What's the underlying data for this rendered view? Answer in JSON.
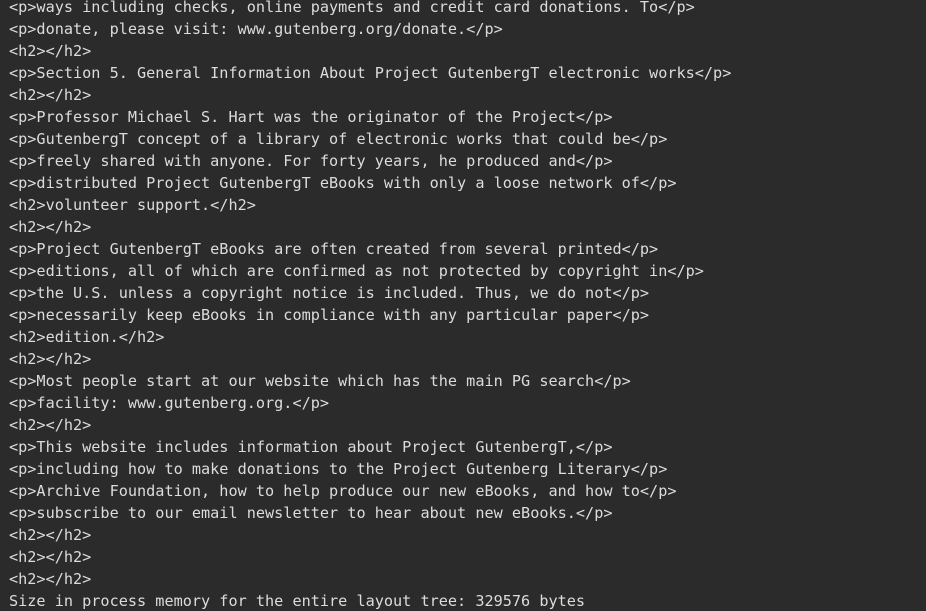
{
  "console": {
    "lines": [
      "<p>ways including checks, online payments and credit card donations. To</p>",
      "<p>donate, please visit: www.gutenberg.org/donate.</p>",
      "<h2></h2>",
      "<p>Section 5. General Information About Project GutenbergT electronic works</p>",
      "<h2></h2>",
      "<p>Professor Michael S. Hart was the originator of the Project</p>",
      "<p>GutenbergT concept of a library of electronic works that could be</p>",
      "<p>freely shared with anyone. For forty years, he produced and</p>",
      "<p>distributed Project GutenbergT eBooks with only a loose network of</p>",
      "<h2>volunteer support.</h2>",
      "<h2></h2>",
      "<p>Project GutenbergT eBooks are often created from several printed</p>",
      "<p>editions, all of which are confirmed as not protected by copyright in</p>",
      "<p>the U.S. unless a copyright notice is included. Thus, we do not</p>",
      "<p>necessarily keep eBooks in compliance with any particular paper</p>",
      "<h2>edition.</h2>",
      "<h2></h2>",
      "<p>Most people start at our website which has the main PG search</p>",
      "<p>facility: www.gutenberg.org.</p>",
      "<h2></h2>",
      "<p>This website includes information about Project GutenbergT,</p>",
      "<p>including how to make donations to the Project Gutenberg Literary</p>",
      "<p>Archive Foundation, how to help produce our new eBooks, and how to</p>",
      "<p>subscribe to our email newsletter to hear about new eBooks.</p>",
      "<h2></h2>",
      "<h2></h2>",
      "<h2></h2>",
      "Size in process memory for the entire layout tree: 329576 bytes"
    ]
  }
}
